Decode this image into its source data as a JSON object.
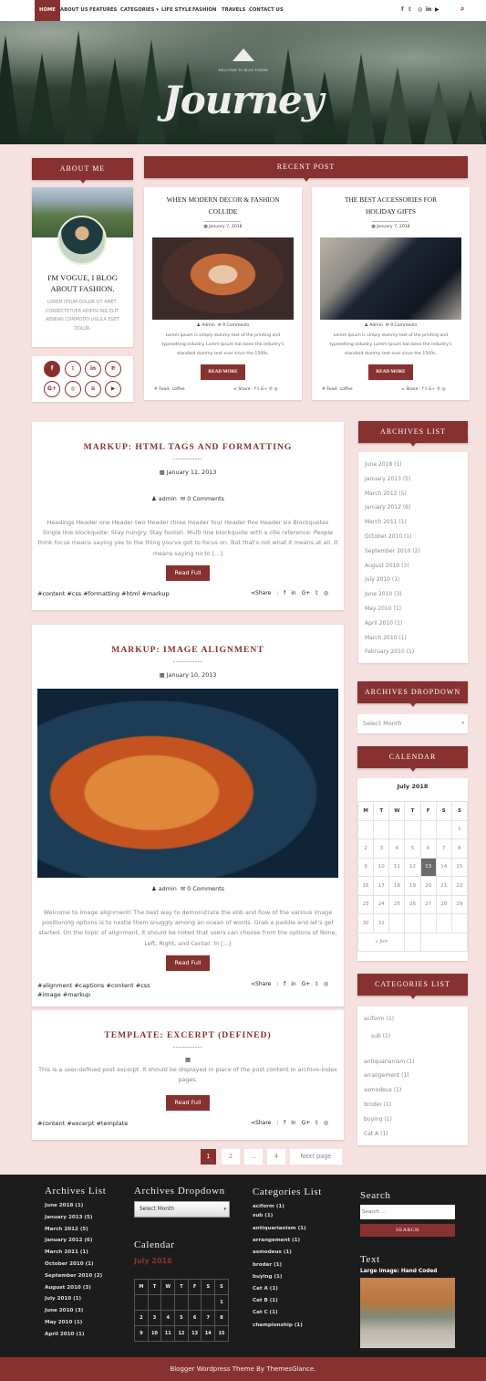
{
  "nav": {
    "items": [
      "HOME",
      "ABOUT US",
      "FEATURES",
      "CATEGORIES ▾",
      "LIFE STYLE",
      "FASHION",
      "TRAVELS",
      "CONTACT US"
    ],
    "social": [
      "f",
      "𝕥",
      "◎",
      "in",
      "▶"
    ],
    "search_icon": "⌕"
  },
  "hero": {
    "subtitle": "WELCOME TO BLOG THEME",
    "title": "Journey"
  },
  "about": {
    "header": "ABOUT ME",
    "heading_line1": "I'M VOGUE, I BLOG",
    "heading_line2": "ABOUT FASHION.",
    "text_line1": "LOREM IPSUM DOLOR SIT AMET,",
    "text_line2": "CONSECTETUER ADIPISCING ELIT.",
    "text_line3": "AENEAN COMMODO LIGULA EGET",
    "text_line4": "DOLOR."
  },
  "social_circles": [
    "f",
    "𝕥",
    "in",
    "℗",
    "G+",
    "◎",
    "≋",
    "▶"
  ],
  "recent": {
    "header": "RECENT POST",
    "posts": [
      {
        "title_line1": "WHEN MODERN DECOR & FASHION",
        "title_line2": "COLLIDE",
        "date": "January 7, 2018",
        "author": "Admin",
        "comments": "9 Comments",
        "excerpt_line1": "Lorem Ipsum is simply dummy text of the printing and",
        "excerpt_line2": "typesetting industry. Lorem Ipsum has been the industry's",
        "excerpt_line3": "standard dummy text ever since the 1500s,",
        "button": "READ MORE",
        "tag": "Food- coffee",
        "share": "Share : f 𝕥 G+ ℗ ◎"
      },
      {
        "title_line1": "THE BEST ACCESSORIES FOR",
        "title_line2": "HOLIDAY GIFTS",
        "date": "January 7, 2018",
        "author": "Admin",
        "comments": "9 Comments",
        "excerpt_line1": "Lorem Ipsum is simply dummy text of the printing and",
        "excerpt_line2": "typesetting industry. Lorem Ipsum has been the industry's",
        "excerpt_line3": "standard dummy text ever since the 1500s,",
        "button": "READ MORE",
        "tag": "Food- coffee",
        "share": "Share : f 𝕥 G+ ℗ ◎"
      }
    ]
  },
  "posts": [
    {
      "title": "MARKUP: HTML TAGS AND FORMATTING",
      "dash": "------------",
      "date": "January 11, 2013",
      "author": "admin",
      "comments": "0 Comments",
      "excerpt": "Headings Header one Header two Header three Header four Header five Header six Blockquotes Single line blockquote: Stay hungry. Stay foolish. Multi line blockquote with a cite reference: People think focus means saying yes to the thing you've got to focus on. But that's not what it means at all. It means saying no to […]",
      "button": "Read Full",
      "tags": "#content #css #formatting #html #markup",
      "share": "Share : f in G+ 𝕥 ◎"
    },
    {
      "title": "MARKUP: IMAGE ALIGNMENT",
      "dash": "------------",
      "date": "January 10, 2013",
      "author": "admin",
      "comments": "0 Comments",
      "excerpt": "Welcome to image alignment! The best way to demonstrate the ebb and flow of the various image positioning options is to nestle them snuggly among an ocean of words. Grab a paddle and let's get started. On the topic of alignment, it should be noted that users can choose from the options of None, Left, Right, and Center. In […]",
      "button": "Read Full",
      "tags_line1": "#alignment #captions #content #css",
      "tags_line2": "#image #markup",
      "share": "Share : f in G+ 𝕥 ◎"
    },
    {
      "title": "TEMPLATE: EXCERPT (DEFINED)",
      "dash": "------------",
      "excerpt": "This is a user-defined post excerpt. It should be displayed in place of the post content in archive-index pages.",
      "button": "Read Full",
      "tags": "#content #excerpt #template",
      "share": "Share : f in G+ 𝕥 ◎"
    }
  ],
  "pagination": [
    "1",
    "2",
    "...",
    "4",
    "Next page"
  ],
  "sidebar": {
    "archives_header": "ARCHIVES LIST",
    "archives": [
      "June 2018 (1)",
      "January 2013 (5)",
      "March 2012 (5)",
      "January 2012 (6)",
      "March 2011 (1)",
      "October 2010 (1)",
      "September 2010 (2)",
      "August 2010 (3)",
      "July 2010 (1)",
      "June 2010 (3)",
      "May 2010 (1)",
      "April 2010 (1)",
      "March 2010 (1)",
      "February 2010 (1)"
    ],
    "dropdown_header": "ARCHIVES DROPDOWN",
    "dropdown_value": "Select Month",
    "calendar_header": "CALENDAR",
    "calendar_month": "July 2018",
    "calendar_days": [
      "M",
      "T",
      "W",
      "T",
      "F",
      "S",
      "S"
    ],
    "calendar_rows": [
      [
        "",
        "",
        "",
        "",
        "",
        "",
        "1"
      ],
      [
        "2",
        "3",
        "4",
        "5",
        "6",
        "7",
        "8"
      ],
      [
        "9",
        "10",
        "11",
        "12",
        "13",
        "14",
        "15"
      ],
      [
        "16",
        "17",
        "18",
        "19",
        "20",
        "21",
        "22"
      ],
      [
        "23",
        "24",
        "25",
        "26",
        "27",
        "28",
        "29"
      ],
      [
        "30",
        "31",
        "",
        "",
        "",
        "",
        ""
      ]
    ],
    "calendar_today": "13",
    "calendar_prev": "« Jun",
    "categories_header": "CATEGORIES LIST",
    "categories": [
      "aciform (1)",
      "sub (1)",
      "antiquarianism (1)",
      "arrangement (1)",
      "asmodeus (1)",
      "broder (1)",
      "buying (1)",
      "Cat A (1)"
    ]
  },
  "footer": {
    "archives_title": "Archives List",
    "archives": [
      "June 2018 (1)",
      "January 2013 (5)",
      "March 2012 (5)",
      "January 2012 (6)",
      "March 2011 (1)",
      "October 2010 (1)",
      "September 2010 (2)",
      "August 2010 (3)",
      "July 2010 (1)",
      "June 2010 (3)",
      "May 2010 (1)",
      "April 2010 (1)"
    ],
    "dropdown_title": "Archives Dropdown",
    "dropdown_value": "Select Month",
    "calendar_title": "Calendar",
    "calendar_month": "July 2018",
    "calendar_days": [
      "M",
      "T",
      "W",
      "T",
      "F",
      "S",
      "S"
    ],
    "calendar_rows": [
      [
        "",
        "",
        "",
        "",
        "",
        "",
        "1"
      ],
      [
        "2",
        "3",
        "4",
        "5",
        "6",
        "7",
        "8"
      ],
      [
        "9",
        "10",
        "11",
        "12",
        "13",
        "14",
        "15"
      ]
    ],
    "categories_title": "Categories List",
    "categories": [
      "aciform (1)",
      "sub (1)",
      "antiquarianism (1)",
      "arrangement (1)",
      "asmodeus (1)",
      "broder (1)",
      "buying (1)",
      "Cat A (1)",
      "Cat B (1)",
      "Cat C (1)",
      "championship (1)"
    ],
    "search_title": "Search",
    "search_placeholder": "Search ...",
    "search_button": "SEARCH",
    "text_title": "Text",
    "text_caption": "Large image: Hand Coded",
    "credit": "Blogger Wordpress Theme By ThemesGlance."
  },
  "colors": {
    "accent": "#873230",
    "page_bg": "#f6e1e1",
    "footer_bg": "#1c1c1c"
  }
}
